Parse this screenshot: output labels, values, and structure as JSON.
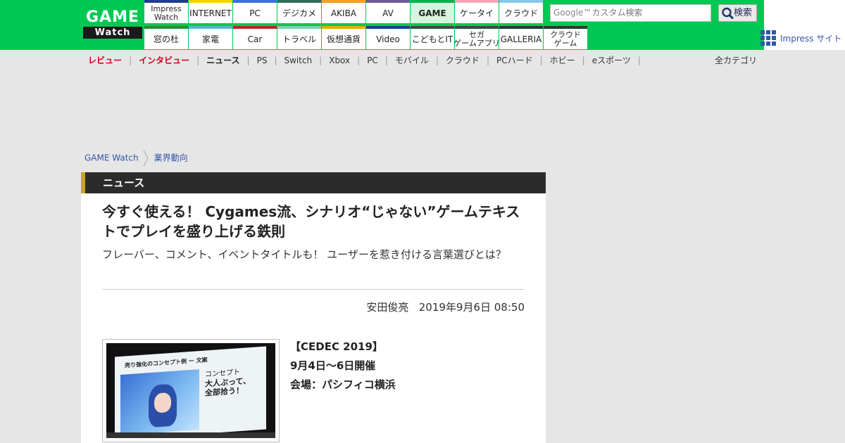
{
  "logo": {
    "line1": "GAME",
    "line2": "Watch"
  },
  "nav": {
    "row1": [
      {
        "label": "Impress\nWatch",
        "color": "#1f3c8f"
      },
      {
        "label": "INTERNET",
        "color": "#f5d000"
      },
      {
        "label": "PC",
        "color": "#3a6fe0"
      },
      {
        "label": "デジカメ",
        "color": "#2f6b5b"
      },
      {
        "label": "AKIBA",
        "color": "#f0a020"
      },
      {
        "label": "AV",
        "color": "#6b5b95"
      },
      {
        "label": "GAME",
        "color": "#00b050",
        "active": true
      },
      {
        "label": "ケータイ",
        "color": "#f4a6b8"
      },
      {
        "label": "クラウド",
        "color": "#87c8e8"
      }
    ],
    "row2": [
      {
        "label": "窓の杜",
        "color": "#2d8a2d"
      },
      {
        "label": "家電",
        "color": "#57b3d9"
      },
      {
        "label": "Car",
        "color": "#c0202a"
      },
      {
        "label": "トラベル",
        "color": "#7fcfb0"
      },
      {
        "label": "仮想通貨",
        "color": "#e0b000"
      },
      {
        "label": "Video",
        "color": "#1f3c8f"
      },
      {
        "label": "こどもとIT",
        "color": "#444444"
      },
      {
        "label": "セガ\nゲームアプリ",
        "color": "#444444"
      },
      {
        "label": "GALLERIA",
        "color": "#333333"
      },
      {
        "label": "クラウド\nゲーム",
        "color": "#333333"
      }
    ]
  },
  "search": {
    "placeholder": "カスタム検索",
    "google": "Google™",
    "button": "検索"
  },
  "impress_site": "Impress サイト",
  "subnav": {
    "items": [
      {
        "label": "レビュー",
        "style": "red"
      },
      {
        "label": "インタビュー",
        "style": "red"
      },
      {
        "label": "ニュース",
        "style": "bold"
      },
      {
        "label": "PS",
        "style": ""
      },
      {
        "label": "Switch",
        "style": ""
      },
      {
        "label": "Xbox",
        "style": ""
      },
      {
        "label": "PC",
        "style": ""
      },
      {
        "label": "モバイル",
        "style": ""
      },
      {
        "label": "クラウド",
        "style": ""
      },
      {
        "label": "PCハード",
        "style": ""
      },
      {
        "label": "ホビー",
        "style": ""
      },
      {
        "label": "eスポーツ",
        "style": ""
      }
    ],
    "all_categories": "全カテゴリ"
  },
  "breadcrumb": [
    "GAME Watch",
    "業界動向"
  ],
  "section": "ニュース",
  "article": {
    "title": "今すぐ使える！ Cygames流、シナリオ“じゃない”ゲームテキストでプレイを盛り上げる鉄則",
    "subtitle": "フレーバー、コメント、イベントタイトルも！ ユーザーを惹き付ける言葉選びとは？",
    "author": "安田俊亮",
    "date": "2019年9月6日 08:50",
    "event_lines": [
      "【CEDEC 2019】",
      "9月4日～6日開催",
      "会場：パシフィコ横浜"
    ],
    "photo": {
      "slide_heading": "売り強化のコンセプト例 ー 文案",
      "slide_small": "コンセプト",
      "slide_big1": "大人ぶって、",
      "slide_big2": "全部拾う！"
    }
  }
}
